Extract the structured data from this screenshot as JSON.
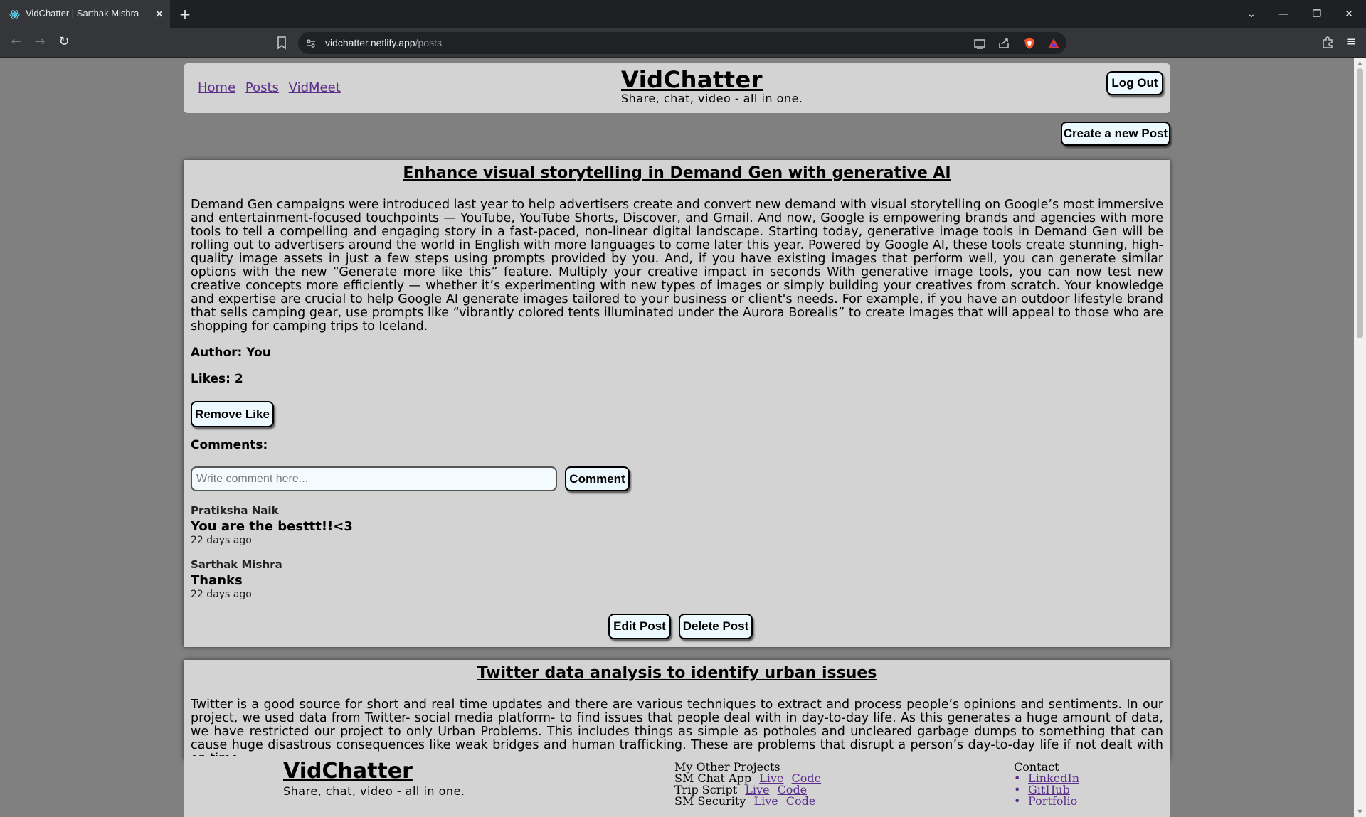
{
  "browser": {
    "tab_title": "VidChatter | Sarthak Mishra",
    "url_domain": "vidchatter.netlify.app",
    "url_path": "/posts",
    "close_glyph": "✕",
    "newtab_glyph": "+",
    "back_glyph": "←",
    "forward_glyph": "→",
    "reload_glyph": "↻",
    "minimize_glyph": "—",
    "restore_glyph": "❐",
    "close_window_glyph": "✕",
    "tab_list_glyph": "⌄",
    "menu_glyph": "≡"
  },
  "header": {
    "nav": [
      "Home",
      "Posts",
      "VidMeet"
    ],
    "title": "VidChatter",
    "tagline": "Share, chat, video - all in one.",
    "logout_label": "Log Out"
  },
  "create_post_label": "Create a new Post",
  "posts": [
    {
      "title": "Enhance visual storytelling in Demand Gen with generative AI",
      "body": "Demand Gen campaigns were introduced last year to help advertisers create and convert new demand with visual storytelling on Google’s most immersive and entertainment-focused touchpoints — YouTube, YouTube Shorts, Discover, and Gmail. And now, Google is empowering brands and agencies with more tools to tell a compelling and engaging story in a fast-paced, non-linear digital landscape. Starting today, generative image tools in Demand Gen will be rolling out to advertisers around the world in English with more languages to come later this year. Powered by Google AI, these tools create stunning, high-quality image assets in just a few steps using prompts provided by you. And, if you have existing images that perform well, you can generate similar options with the new “Generate more like this” feature. Multiply your creative impact in seconds With generative image tools, you can now test new creative concepts more efficiently — whether it’s experimenting with new types of images or simply building your creatives from scratch. Your knowledge and expertise are crucial to help Google AI generate images tailored to your business or client's needs. For example, if you have an outdoor lifestyle brand that sells camping gear, use prompts like “vibrantly colored tents illuminated under the Aurora Borealis” to create images that will appeal to those who are shopping for camping trips to Iceland.",
      "author": "Author: You",
      "likes": "Likes: 2",
      "like_button": "Remove Like",
      "comments_heading": "Comments:",
      "comment_placeholder": "Write comment here...",
      "comment_button": "Comment",
      "comments": [
        {
          "name": "Pratiksha Naik",
          "text": "You are the besttt!!<3",
          "time": "22 days ago"
        },
        {
          "name": "Sarthak Mishra",
          "text": "Thanks",
          "time": "22 days ago"
        }
      ],
      "edit_button": "Edit Post",
      "delete_button": "Delete Post"
    },
    {
      "title": "Twitter data analysis to identify urban issues",
      "body": "Twitter is a good source for short and real time updates and there are various techniques to extract and process people’s opinions and sentiments. In our project, we used data from Twitter- social media platform- to find issues that people deal with in day-to-day life. As this generates a huge amount of data, we have restricted our project to only Urban Problems. This includes things as simple as potholes and uncleared garbage dumps to something that can cause huge disastrous consequences like weak bridges and human trafficking. These are problems that disrupt a person’s day-to-day life if not dealt with on time."
    }
  ],
  "footer": {
    "title": "VidChatter",
    "tagline": "Share, chat, video - all in one.",
    "projects_heading": "My Other Projects",
    "projects": [
      {
        "name": "SM Chat App",
        "live": "Live",
        "code": "Code"
      },
      {
        "name": "Trip Script",
        "live": "Live",
        "code": "Code"
      },
      {
        "name": "SM Security",
        "live": "Live",
        "code": "Code"
      }
    ],
    "contact_heading": "Contact",
    "contacts": [
      "LinkedIn",
      "GitHub",
      "Portfolio"
    ]
  }
}
